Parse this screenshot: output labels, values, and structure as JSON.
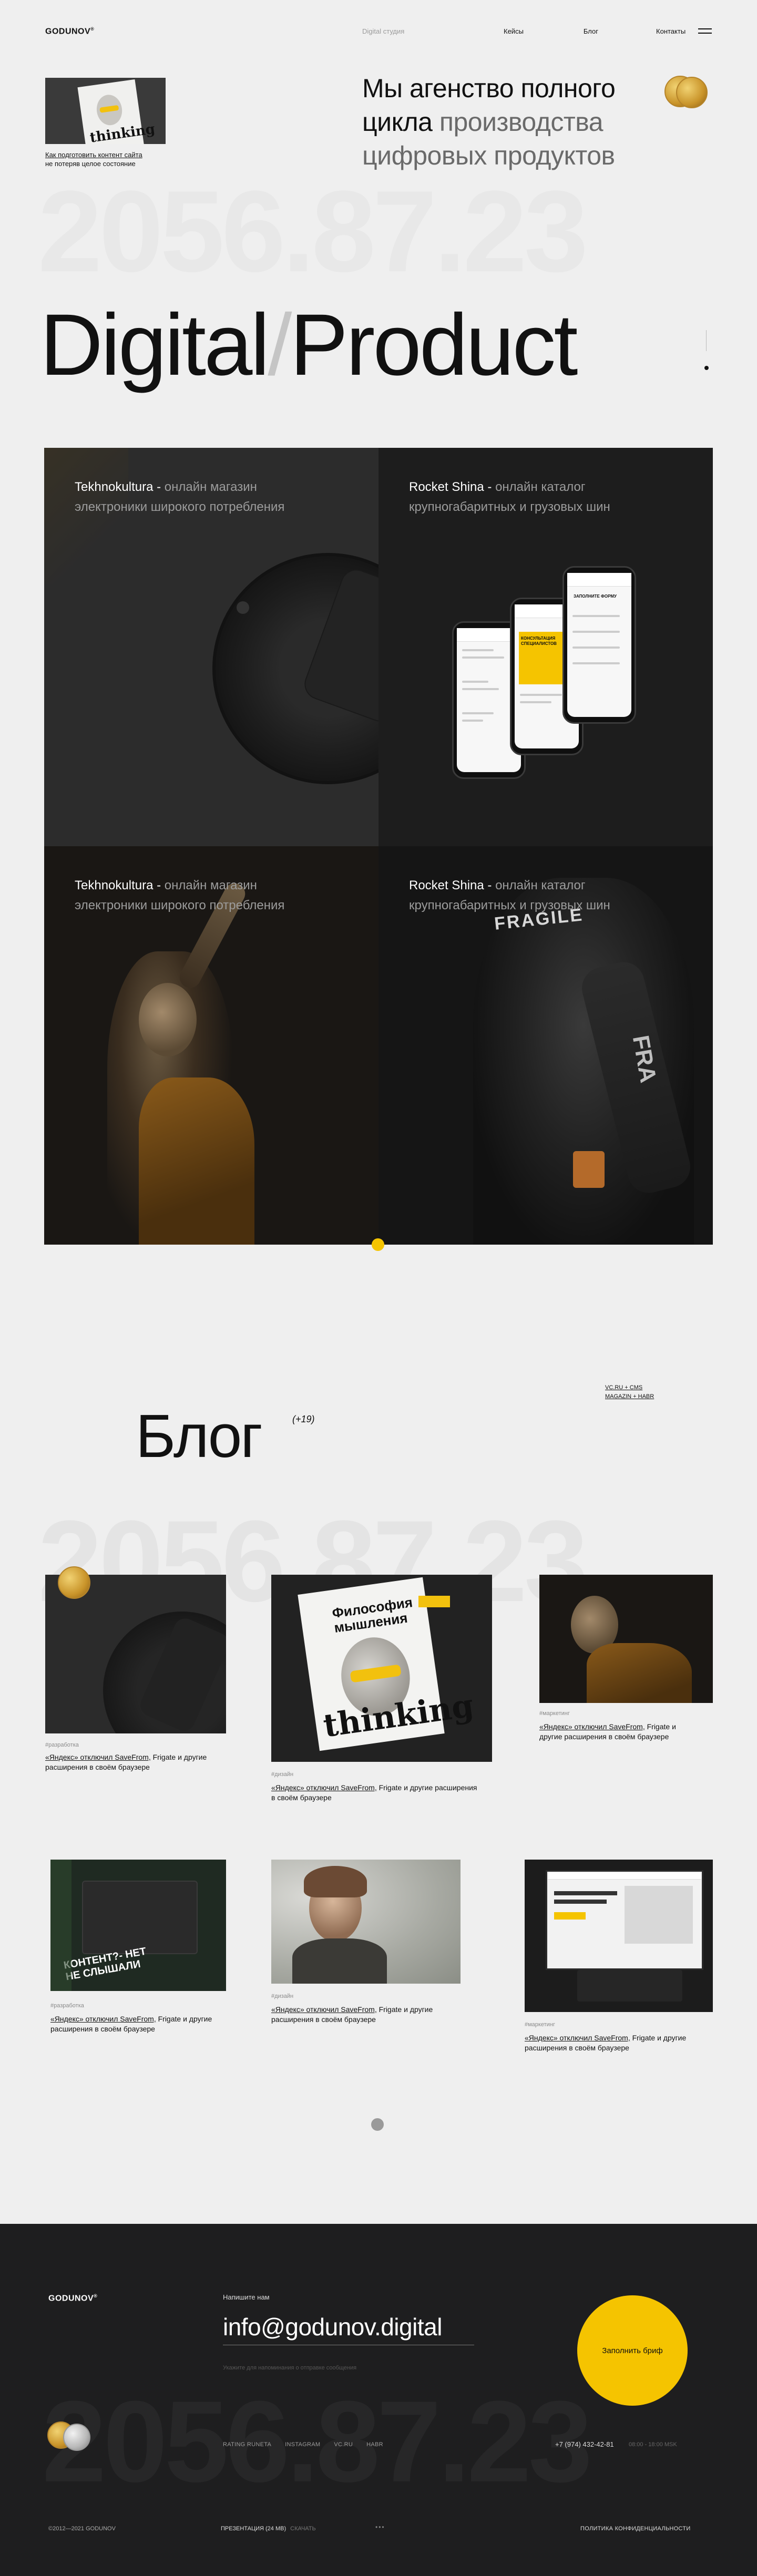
{
  "header": {
    "logo": "GODUNOV",
    "logo_mark": "®",
    "studio": "Digital студия",
    "nav": [
      "Кейсы",
      "Блог",
      "Контакты"
    ]
  },
  "hero": {
    "card_word": "thinking",
    "card_caption_link": "Как подготовить контент сайта",
    "card_caption_rest": "не потеряв целое состояние",
    "title_1": "Мы агенство полного",
    "title_2a": "цикла ",
    "title_2b": "производства",
    "title_3": "цифровых продуктов",
    "bignum": "2056.87.23",
    "digital": "Digital",
    "slash": "/",
    "product": "Product"
  },
  "cases": [
    {
      "name": "Tekhnokultura",
      "sep": " - ",
      "desc": "онлайн магазин электроники широкого потребления"
    },
    {
      "name": "Rocket Shina",
      "sep": " - ",
      "desc": "онлайн каталог крупногабаритных и грузовых шин"
    },
    {
      "name": "Tekhnokultura",
      "sep": " - ",
      "desc": "онлайн магазин электроники широкого потребления"
    },
    {
      "name": "Rocket Shina",
      "sep": " - ",
      "desc": "онлайн каталог крупногабаритных и грузовых шин"
    }
  ],
  "case_art": {
    "fragile": "FRAGILE",
    "fra": "FRA",
    "phone_block": "КОНСУЛЬТАЦИЯ СПЕЦИАЛИСТОВ",
    "phone_form": "ЗАПОЛНИТЕ ФОРМУ"
  },
  "blog": {
    "title": "Блог",
    "count": "(+19)",
    "tags_1": "VC.RU + CMS",
    "tags_2": "MAGAZIN + HABR",
    "bignum": "2056.87.23",
    "posts": [
      {
        "tag": "#разработка",
        "title_link": "«Яндекс» отключил SaveFrom,",
        "title_rest": " Frigate и другие расширения в своём браузере"
      },
      {
        "tag": "#дизайн",
        "title_link": "«Яндекс» отключил SaveFrom,",
        "title_rest": " Frigate и другие расширения в своём браузере"
      },
      {
        "tag": "#маркетинг",
        "title_link": "«Яндекс» отключил SaveFrom,",
        "title_rest": " Frigate и другие расширения в своём браузере"
      },
      {
        "tag": "#разработка",
        "title_link": "«Яндекс» отключил SaveFrom,",
        "title_rest": " Frigate и другие расширения в своём браузере"
      },
      {
        "tag": "#дизайн",
        "title_link": "«Яндекс» отключил SaveFrom,",
        "title_rest": " Frigate и другие расширения в своём браузере"
      },
      {
        "tag": "#маркетинг",
        "title_link": "«Яндекс» отключил SaveFrom,",
        "title_rest": " Frigate и другие расширения в своём браузере"
      }
    ],
    "mag_title": "Философия мышления",
    "mag_word": "thinking",
    "post4_word": "КОНТЕНТ?- НЕТ НЕ СЛЫШАЛИ"
  },
  "footer": {
    "logo": "GODUNOV",
    "logo_mark": "®",
    "write_us": "Напишите нам",
    "email": "info@godunov.digital",
    "hint": "Укажите для напоминания о отправке сообщения",
    "brief_button": "Заполнить бриф",
    "bignum": "2056.87.23",
    "links": [
      "RATING RUNETA",
      "INSTAGRAM",
      "VC.RU",
      "HABR"
    ],
    "phone": "+7 (974) 432-42-81",
    "hours": "08:00 - 18:00 MSK",
    "copyright": "©2012—2021 GODUNOV",
    "presentation": "ПРЕЗЕНТАЦИЯ (24 MB)",
    "download": "СКАЧАТЬ",
    "dots": "•••",
    "policy": "ПОЛИТИКА КОНФИДЕНЦИАЛЬНОСТИ"
  },
  "colors": {
    "accent": "#f5c400",
    "background": "#efefef",
    "footer": "#1e1e1f"
  }
}
